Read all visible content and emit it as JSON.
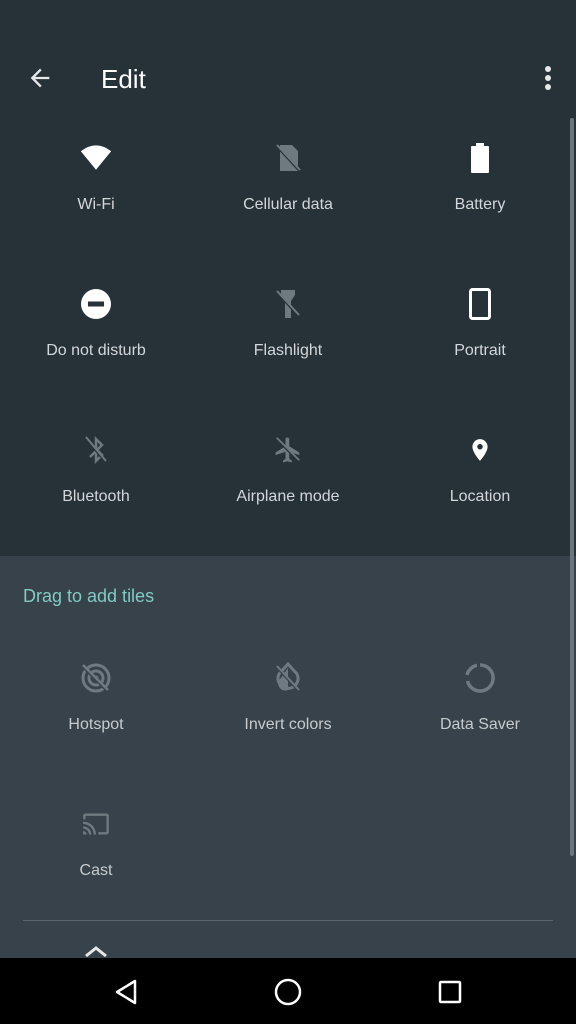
{
  "header": {
    "title": "Edit"
  },
  "active_tiles": [
    {
      "label": "Wi-Fi",
      "icon": "wifi-icon"
    },
    {
      "label": "Cellular data",
      "icon": "cellular-off-icon"
    },
    {
      "label": "Battery",
      "icon": "battery-icon"
    },
    {
      "label": "Do not disturb",
      "icon": "do-not-disturb-icon"
    },
    {
      "label": "Flashlight",
      "icon": "flashlight-off-icon"
    },
    {
      "label": "Portrait",
      "icon": "portrait-icon"
    },
    {
      "label": "Bluetooth",
      "icon": "bluetooth-off-icon"
    },
    {
      "label": "Airplane mode",
      "icon": "airplane-off-icon"
    },
    {
      "label": "Location",
      "icon": "location-icon"
    }
  ],
  "add_section": {
    "header": "Drag to add tiles",
    "tiles": [
      {
        "label": "Hotspot",
        "icon": "hotspot-off-icon"
      },
      {
        "label": "Invert colors",
        "icon": "invert-colors-off-icon"
      },
      {
        "label": "Data Saver",
        "icon": "data-saver-icon"
      },
      {
        "label": "Cast",
        "icon": "cast-icon"
      }
    ]
  },
  "colors": {
    "background": "#263238",
    "add_background": "#37424a",
    "accent": "#80cbc4"
  }
}
